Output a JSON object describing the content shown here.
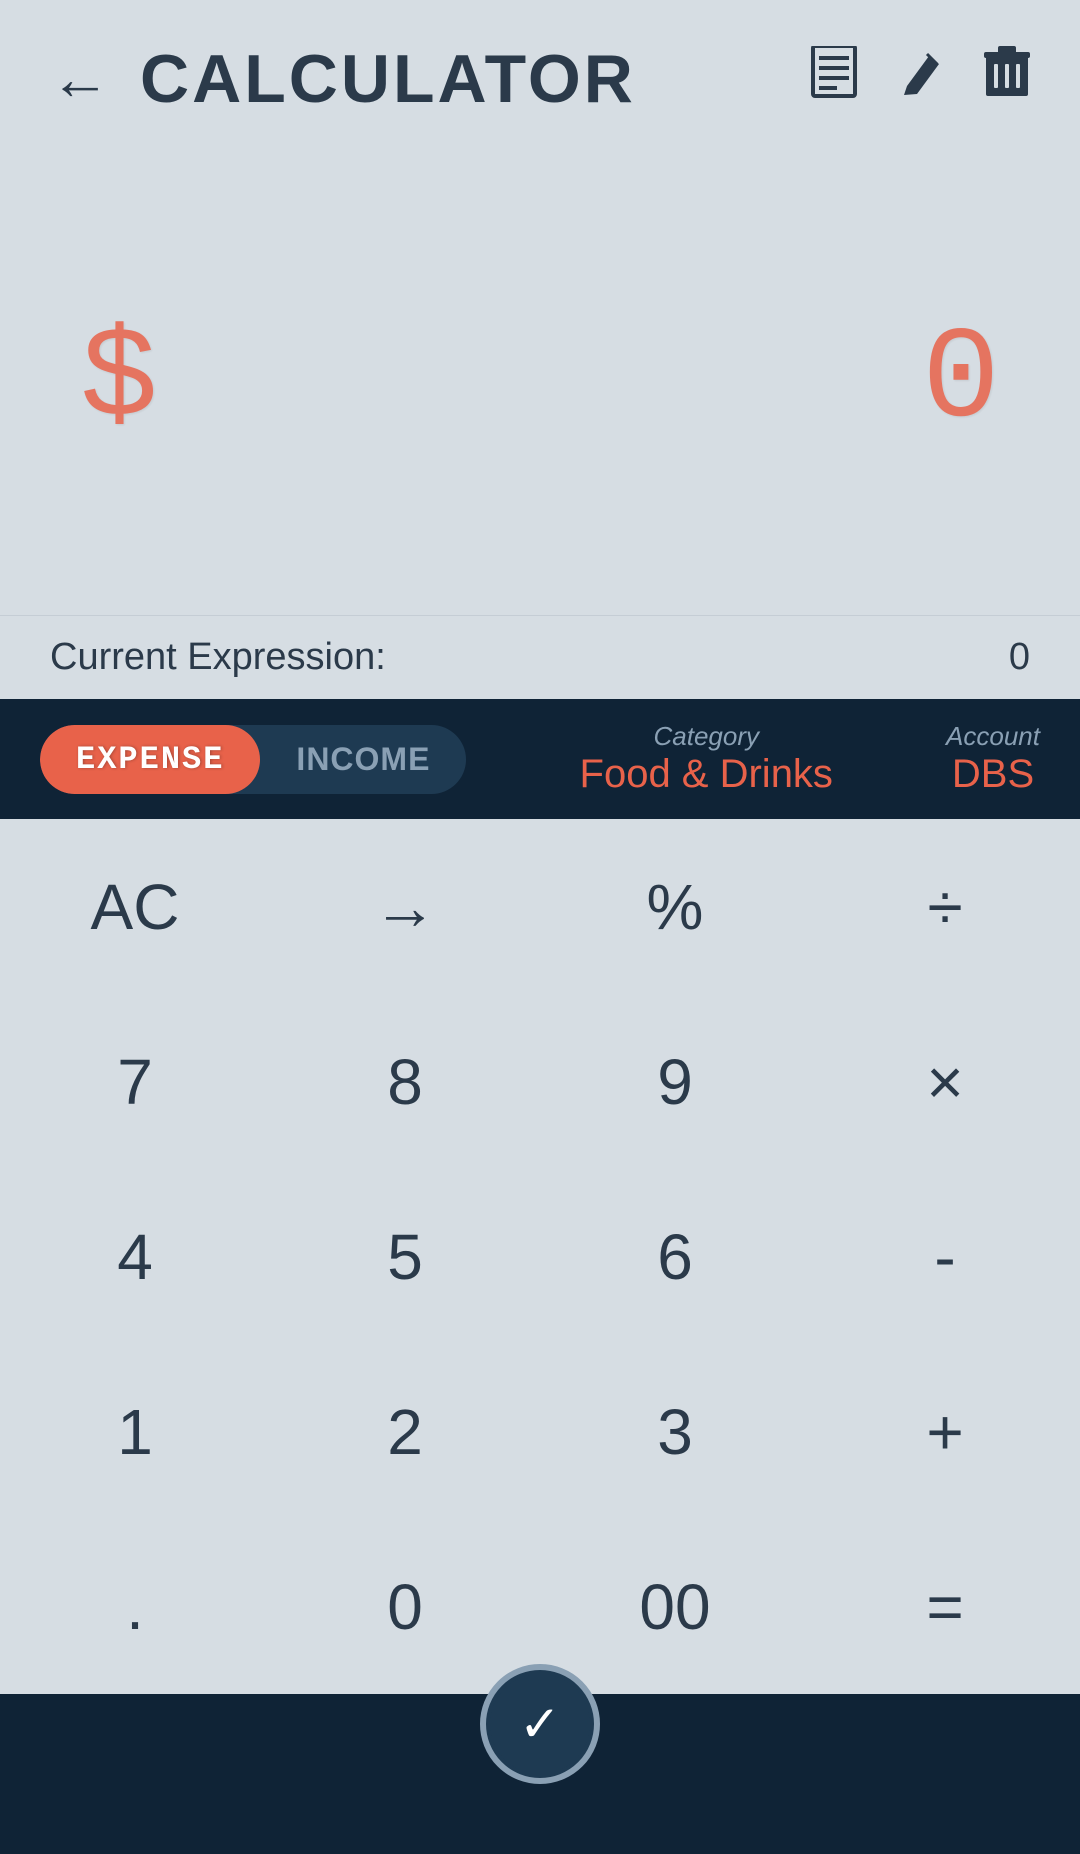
{
  "header": {
    "title": "CALCULATOR",
    "back_icon": "←",
    "receipt_icon": "≡",
    "edit_icon": "✎",
    "delete_icon": "🗑"
  },
  "display": {
    "currency_symbol": "$",
    "amount": "0",
    "expression_label": "Current Expression:",
    "expression_value": "0"
  },
  "toggle": {
    "expense_label": "EXPENSE",
    "income_label": "INCOME"
  },
  "category": {
    "label": "Category",
    "value": "Food & Drinks"
  },
  "account": {
    "label": "Account",
    "value": "DBS"
  },
  "keypad": {
    "rows": [
      [
        "AC",
        "→",
        "%",
        "÷"
      ],
      [
        "7",
        "8",
        "9",
        "×"
      ],
      [
        "4",
        "5",
        "6",
        "-"
      ],
      [
        "1",
        "2",
        "3",
        "+"
      ],
      [
        ".",
        "0",
        "00",
        "="
      ]
    ]
  },
  "confirm_button": {
    "checkmark": "✓"
  }
}
